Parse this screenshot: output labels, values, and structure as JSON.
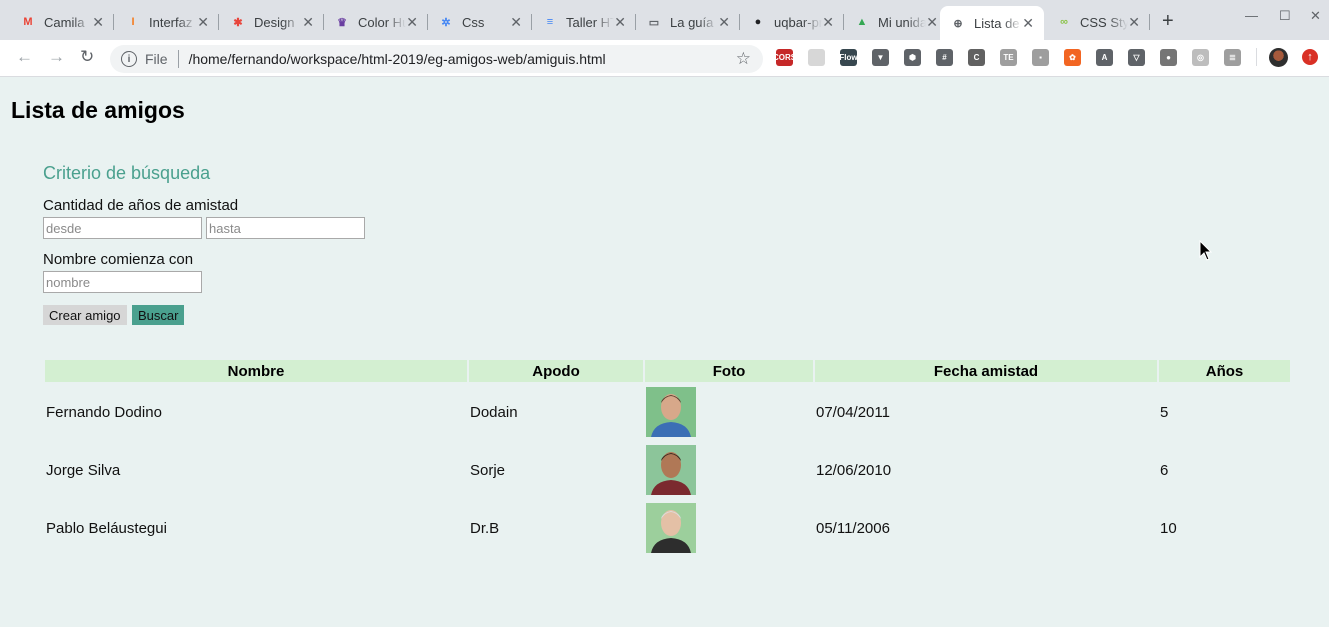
{
  "browser": {
    "tabs": [
      {
        "title": "Camila",
        "icon": "gmail-icon",
        "fav": "M",
        "color": "#ea4335",
        "active": false
      },
      {
        "title": "Interfaz",
        "icon": "interfaz-icon",
        "fav": "I",
        "color": "#f57c1f",
        "active": false
      },
      {
        "title": "Design",
        "icon": "design-icon",
        "fav": "✱",
        "color": "#e8453c",
        "active": false
      },
      {
        "title": "Color Hunt",
        "icon": "color-hunt-icon",
        "fav": "♛",
        "color": "#6a3ea1",
        "active": false
      },
      {
        "title": "Css",
        "icon": "css-icon",
        "fav": "✲",
        "color": "#4285f4",
        "active": false
      },
      {
        "title": "Taller HTML",
        "icon": "google-docs-icon",
        "fav": "≡",
        "color": "#4285f4",
        "active": false
      },
      {
        "title": "La guía",
        "icon": "la-guia-icon",
        "fav": "▭",
        "color": "#5f6368",
        "active": false
      },
      {
        "title": "uqbar-project",
        "icon": "github-icon",
        "fav": "●",
        "color": "#202124",
        "active": false
      },
      {
        "title": "Mi unidad",
        "icon": "google-drive-icon",
        "fav": "▲",
        "color": "#34a853",
        "active": false
      },
      {
        "title": "Lista de amigos",
        "icon": "globe-icon",
        "fav": "⊕",
        "color": "#5f6368",
        "active": true
      },
      {
        "title": "CSS Styles",
        "icon": "css-styles-icon",
        "fav": "∞",
        "color": "#8bc34a",
        "active": false
      }
    ],
    "url_scheme": "File",
    "url": "/home/fernando/workspace/html-2019/eg-amigos-web/amiguis.html",
    "extensions": [
      {
        "name": "cors-extension-icon",
        "label": "CORS",
        "color": "#c62828"
      },
      {
        "name": "grid-extension-icon",
        "label": "",
        "color": "#d7d7d7"
      },
      {
        "name": "flow-extension-icon",
        "label": "Flow",
        "color": "#37474f"
      },
      {
        "name": "vue-devtools-icon",
        "label": "▼",
        "color": "#5f6368"
      },
      {
        "name": "cube-extension-icon",
        "label": "⬢",
        "color": "#5f6368"
      },
      {
        "name": "hash-extension-icon",
        "label": "#",
        "color": "#5f6368"
      },
      {
        "name": "c-extension-icon",
        "label": "C",
        "color": "#616161"
      },
      {
        "name": "te-extension-icon",
        "label": "TE",
        "color": "#9e9e9e"
      },
      {
        "name": "puzzle-extension-icon",
        "label": "▪",
        "color": "#9e9e9e"
      },
      {
        "name": "ubuntu-extension-icon",
        "label": "✿",
        "color": "#f26522"
      },
      {
        "name": "a-extension-icon",
        "label": "A",
        "color": "#5f6368"
      },
      {
        "name": "vuetify-extension-icon",
        "label": "▽",
        "color": "#5f6368"
      },
      {
        "name": "bulb-extension-icon",
        "label": "●",
        "color": "#757575"
      },
      {
        "name": "timer-extension-icon",
        "label": "◎",
        "color": "#bdbdbd"
      },
      {
        "name": "reader-extension-icon",
        "label": "≣",
        "color": "#9e9e9e"
      }
    ]
  },
  "page": {
    "title": "Lista de amigos",
    "search": {
      "title": "Criterio de búsqueda",
      "years_label": "Cantidad de años de amistad",
      "from_placeholder": "desde",
      "to_placeholder": "hasta",
      "name_label": "Nombre comienza con",
      "name_placeholder": "nombre",
      "create_button": "Crear amigo",
      "search_button": "Buscar"
    },
    "table": {
      "headers": [
        "Nombre",
        "Apodo",
        "Foto",
        "Fecha amistad",
        "Años"
      ],
      "rows": [
        {
          "nombre": "Fernando Dodino",
          "apodo": "Dodain",
          "fecha": "07/04/2011",
          "anios": "5",
          "photo_bg": "#7fc08a",
          "shirt": "#3b6fb5",
          "skin": "#d7a88a",
          "hair": "#5a4030"
        },
        {
          "nombre": "Jorge Silva",
          "apodo": "Sorje",
          "fecha": "12/06/2010",
          "anios": "6",
          "photo_bg": "#8cc59a",
          "shirt": "#7b2a2f",
          "skin": "#b07856",
          "hair": "#3a2a20"
        },
        {
          "nombre": "Pablo Beláustegui",
          "apodo": "Dr.B",
          "fecha": "05/11/2006",
          "anios": "10",
          "photo_bg": "#9ccf9c",
          "shirt": "#2d2d2d",
          "skin": "#e4c0a6",
          "hair": "#dddddd"
        }
      ]
    }
  }
}
